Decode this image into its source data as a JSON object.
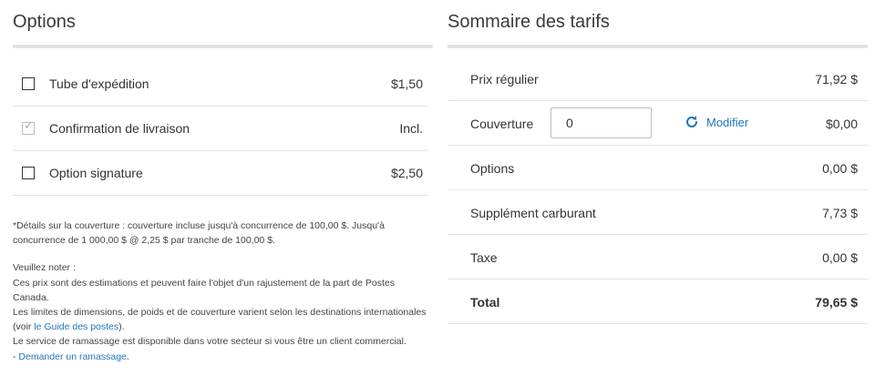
{
  "options": {
    "title": "Options",
    "items": [
      {
        "label": "Tube d'expédition",
        "price": "$1,50",
        "checked": false
      },
      {
        "label": "Confirmation de livraison",
        "price": "Incl.",
        "checked": true
      },
      {
        "label": "Option signature",
        "price": "$2,50",
        "checked": false
      }
    ],
    "notes": {
      "coverage": "*Détails sur la couverture : couverture incluse jusqu'à concurrence de 100,00 $. Jusqu'à concurrence de 1 000,00 $ @ 2,25 $ par tranche de 100,00 $.",
      "note_heading": "Veuillez noter :",
      "line1": "Ces prix sont des estimations et peuvent faire l'objet d'un rajustement de la part de Postes Canada.",
      "line2_before": "Les limites de dimensions, de poids et de couverture varient selon les destinations internationales (voir ",
      "line2_link": "le Guide des postes",
      "line2_after": ").",
      "line3": "Le service de ramassage est disponible dans votre secteur si vous être un client commercial.",
      "line4_prefix": "- ",
      "line4_link": "Demander un ramassage",
      "line4_after": "."
    }
  },
  "summary": {
    "title": "Sommaire des tarifs",
    "regular_label": "Prix régulier",
    "regular_value": "71,92 $",
    "coverage_label": "Couverture",
    "coverage_input_value": "0",
    "modify_label": "Modifier",
    "coverage_value": "$0,00",
    "options_label": "Options",
    "options_value": "0,00 $",
    "fuel_label": "Supplément carburant",
    "fuel_value": "7,73 $",
    "tax_label": "Taxe",
    "tax_value": "0,00 $",
    "total_label": "Total",
    "total_value": "79,65 $"
  },
  "colors": {
    "link": "#1f75b8",
    "divider": "#e3e3e3",
    "text": "#333333"
  }
}
